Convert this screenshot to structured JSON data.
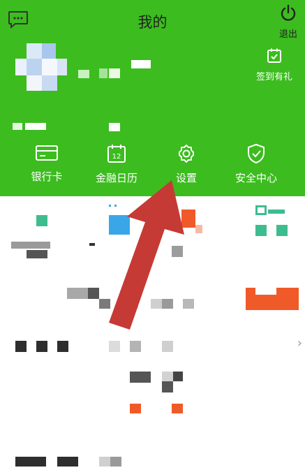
{
  "header": {
    "title": "我的",
    "logout_label": "退出",
    "signin_label": "签到有礼"
  },
  "quick_actions": [
    {
      "label": "银行卡",
      "icon": "bank-card-icon"
    },
    {
      "label": "金融日历",
      "icon": "calendar-icon",
      "calendar_day": "12"
    },
    {
      "label": "设置",
      "icon": "gear-icon"
    },
    {
      "label": "安全中心",
      "icon": "shield-check-icon"
    }
  ],
  "colors": {
    "header_bg": "#3cbc1f",
    "arrow": "#c63a35",
    "accent_orange": "#f05a28",
    "accent_green": "#3dbd8f",
    "accent_blue": "#3aa6e8"
  }
}
